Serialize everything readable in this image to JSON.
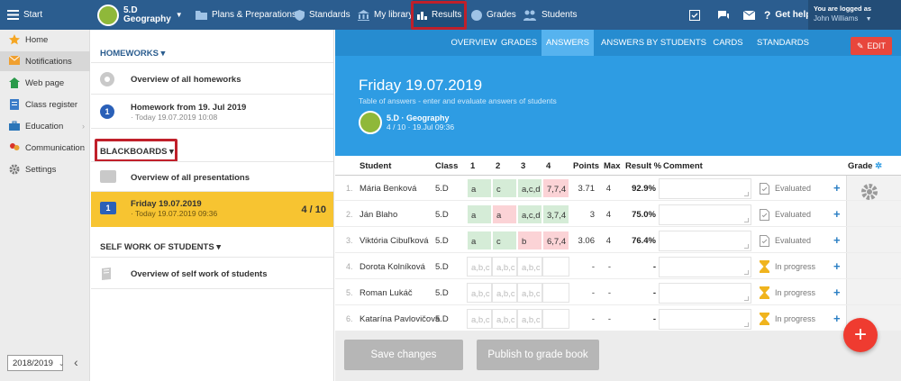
{
  "topbar": {
    "menu_label": "Start",
    "class_name": "5.D",
    "class_subject": "Geography",
    "nav": [
      {
        "label": "Plans & Preparations"
      },
      {
        "label": "Standards"
      },
      {
        "label": "My library"
      },
      {
        "label": "Results"
      },
      {
        "label": "Grades"
      },
      {
        "label": "Students"
      }
    ],
    "help_label": "Get help",
    "logged_as_label": "You are logged as",
    "user_name": "John Williams"
  },
  "sidebar": {
    "items": [
      {
        "label": "Home"
      },
      {
        "label": "Notifications"
      },
      {
        "label": "Web page"
      },
      {
        "label": "Class register"
      },
      {
        "label": "Education"
      },
      {
        "label": "Communication"
      },
      {
        "label": "Settings"
      }
    ],
    "year": "2018/2019",
    "collapse_glyph": "‹"
  },
  "left": {
    "homeworks_header": "HOMEWORKS ▾",
    "homework_overview": "Overview of all homeworks",
    "homework_title": "Homework from 19. Jul 2019",
    "homework_date": "· Today 19.07.2019 10:08",
    "homework_badge": "1",
    "blackboards_header": "BLACKBOARDS ▾",
    "presentations_overview": "Overview of all presentations",
    "bb_title": "Friday 19.07.2019",
    "bb_date": "· Today 19.07.2019 09:36",
    "bb_badge": "1",
    "bb_count": "4 / 10",
    "selfwork_header": "SELF WORK OF STUDENTS ▾",
    "selfwork_overview": "Overview of self work of students"
  },
  "main": {
    "tabs": [
      {
        "label": "OVERVIEW"
      },
      {
        "label": "GRADES"
      },
      {
        "label": "ANSWERS"
      },
      {
        "label": "ANSWERS BY STUDENTS"
      },
      {
        "label": "CARDS"
      },
      {
        "label": "STANDARDS"
      }
    ],
    "edit_label": "EDIT",
    "title": "Friday 19.07.2019",
    "subtitle": "Table of answers - enter and evaluate answers of students",
    "class_line": "5.D · Geography",
    "date_line": "4 / 10 · 19.Jul 09:36"
  },
  "table": {
    "headers": {
      "student": "Student",
      "class": "Class",
      "q1": "1",
      "q2": "2",
      "q3": "3",
      "q4": "4",
      "points": "Points",
      "max": "Max",
      "result": "Result %",
      "comment": "Comment",
      "grade": "Grade"
    },
    "rows": [
      {
        "num": "1.",
        "name": "Mária Benková",
        "class": "5.D",
        "answers": [
          {
            "v": "a",
            "s": "g"
          },
          {
            "v": "c",
            "s": "g"
          },
          {
            "v": "a,c,d",
            "s": "g"
          },
          {
            "v": "7,7,4",
            "s": "r"
          }
        ],
        "points": "3.71",
        "max": "4",
        "result": "92.9%",
        "status": "Evaluated",
        "done": true
      },
      {
        "num": "2.",
        "name": "Ján Blaho",
        "class": "5.D",
        "answers": [
          {
            "v": "a",
            "s": "g"
          },
          {
            "v": "a",
            "s": "r"
          },
          {
            "v": "a,c,d",
            "s": "g"
          },
          {
            "v": "3,7,4",
            "s": "g"
          }
        ],
        "points": "3",
        "max": "4",
        "result": "75.0%",
        "status": "Evaluated",
        "done": true
      },
      {
        "num": "3.",
        "name": "Viktória Cibuľková",
        "class": "5.D",
        "answers": [
          {
            "v": "a",
            "s": "g"
          },
          {
            "v": "c",
            "s": "g"
          },
          {
            "v": "b",
            "s": "r"
          },
          {
            "v": "6,7,4",
            "s": "r"
          }
        ],
        "points": "3.06",
        "max": "4",
        "result": "76.4%",
        "status": "Evaluated",
        "done": true
      },
      {
        "num": "4.",
        "name": "Dorota Kolníková",
        "class": "5.D",
        "answers": [
          {
            "v": "a,b,c",
            "s": "e"
          },
          {
            "v": "a,b,c",
            "s": "e"
          },
          {
            "v": "a,b,c",
            "s": "e"
          },
          {
            "v": "",
            "s": "e"
          }
        ],
        "points": "-",
        "max": "-",
        "result": "-",
        "status": "In progress",
        "done": false
      },
      {
        "num": "5.",
        "name": "Roman Lukáč",
        "class": "5.D",
        "answers": [
          {
            "v": "a,b,c",
            "s": "e"
          },
          {
            "v": "a,b,c",
            "s": "e"
          },
          {
            "v": "a,b,c",
            "s": "e"
          },
          {
            "v": "",
            "s": "e"
          }
        ],
        "points": "-",
        "max": "-",
        "result": "-",
        "status": "In progress",
        "done": false
      },
      {
        "num": "6.",
        "name": "Katarína Pavlovičová",
        "class": "5.D",
        "answers": [
          {
            "v": "a,b,c",
            "s": "e"
          },
          {
            "v": "a,b,c",
            "s": "e"
          },
          {
            "v": "a,b,c",
            "s": "e"
          },
          {
            "v": "",
            "s": "e"
          }
        ],
        "points": "-",
        "max": "-",
        "result": "-",
        "status": "In progress",
        "done": false
      }
    ]
  },
  "footer": {
    "save_label": "Save changes",
    "publish_label": "Publish to grade book"
  },
  "colors": {
    "topbar": "#2b5d8f",
    "accent_blue": "#2e9ce3",
    "selected_yellow": "#f7c431",
    "highlight_red": "#c0202a",
    "fab_red": "#ef3b30"
  }
}
